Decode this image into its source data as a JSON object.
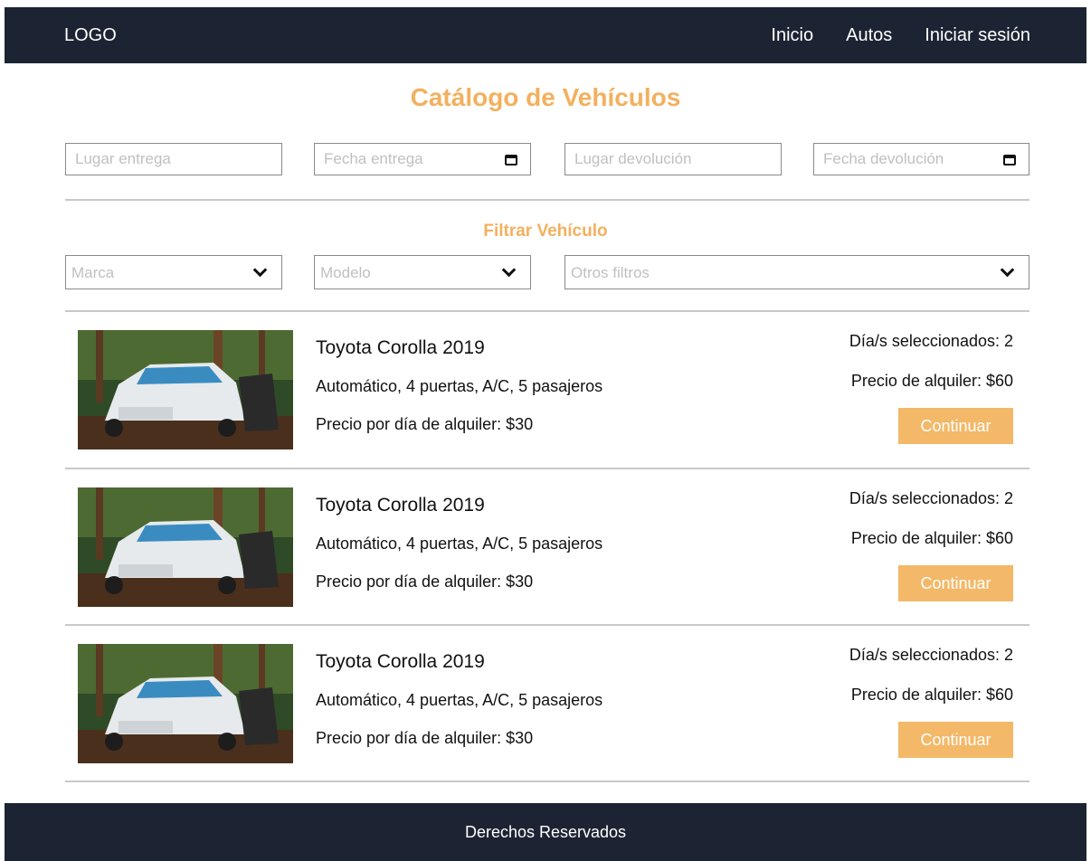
{
  "header": {
    "logo": "LOGO",
    "nav": [
      "Inicio",
      "Autos",
      "Iniciar sesión"
    ]
  },
  "page_title": "Catálogo de Vehículos",
  "search": {
    "pickup_place_placeholder": "Lugar entrega",
    "pickup_date_placeholder": "Fecha entrega",
    "return_place_placeholder": "Lugar devolución",
    "return_date_placeholder": "Fecha devolución"
  },
  "filters": {
    "title": "Filtrar Vehículo",
    "brand": "Marca",
    "model": "Modelo",
    "other": "Otros filtros"
  },
  "vehicles": [
    {
      "title": "Toyota Corolla 2019",
      "specs": "Automático, 4 puertas, A/C, 5 pasajeros",
      "daily_price": "Precio por día de alquiler: $30",
      "days": "Día/s seleccionados: 2",
      "total": "Precio de alquiler: $60",
      "button": "Continuar"
    },
    {
      "title": "Toyota Corolla 2019",
      "specs": "Automático, 4 puertas, A/C, 5 pasajeros",
      "daily_price": "Precio por día de alquiler: $30",
      "days": "Día/s seleccionados: 2",
      "total": "Precio de alquiler: $60",
      "button": "Continuar"
    },
    {
      "title": "Toyota Corolla 2019",
      "specs": "Automático, 4 puertas, A/C, 5 pasajeros",
      "daily_price": "Precio por día de alquiler: $30",
      "days": "Día/s seleccionados: 2",
      "total": "Precio de alquiler: $60",
      "button": "Continuar"
    }
  ],
  "footer": {
    "text": "Derechos Reservados"
  },
  "colors": {
    "navbar": "#1c2433",
    "accent": "#f3b05e",
    "button": "#f3b868"
  },
  "icons": [
    "calendar-icon",
    "chevron-down-icon"
  ]
}
